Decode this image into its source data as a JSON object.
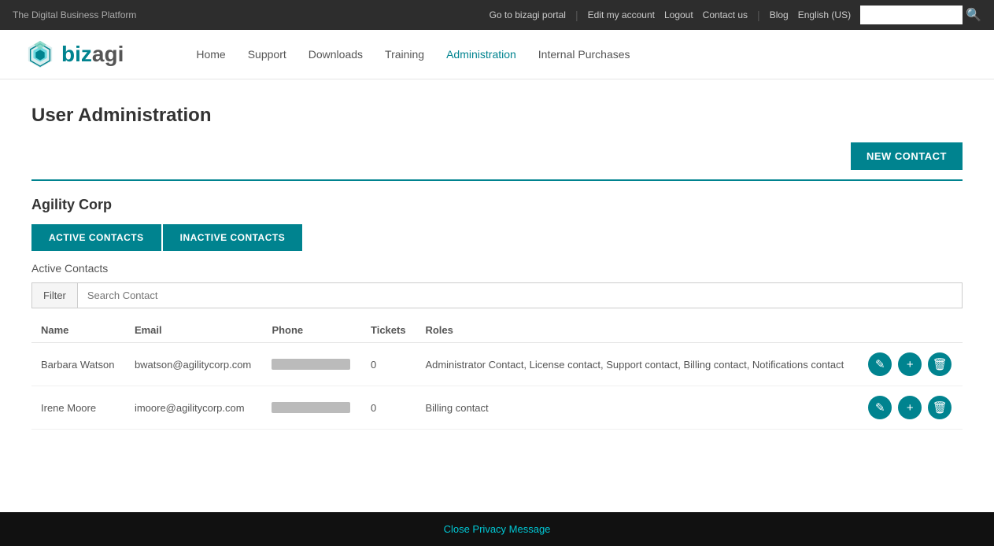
{
  "topbar": {
    "site_name": "The Digital Business Platform",
    "links": [
      {
        "label": "Go to bizagi portal",
        "id": "bizagi-portal"
      },
      {
        "label": "Edit my account",
        "id": "edit-account"
      },
      {
        "label": "Logout",
        "id": "logout"
      },
      {
        "label": "Contact us",
        "id": "contact-us"
      },
      {
        "label": "Blog",
        "id": "blog"
      }
    ],
    "language": "English (US)",
    "search_placeholder": ""
  },
  "navbar": {
    "logo_text_prefix": "bizagi",
    "links": [
      {
        "label": "Home",
        "id": "home",
        "active": false
      },
      {
        "label": "Support",
        "id": "support",
        "active": false
      },
      {
        "label": "Downloads",
        "id": "downloads",
        "active": false
      },
      {
        "label": "Training",
        "id": "training",
        "active": false
      },
      {
        "label": "Administration",
        "id": "administration",
        "active": true
      },
      {
        "label": "Internal Purchases",
        "id": "internal-purchases",
        "active": false
      }
    ]
  },
  "main": {
    "page_title": "User Administration",
    "new_contact_label": "NEW CONTACT",
    "company_name": "Agility Corp",
    "tabs": [
      {
        "label": "ACTIVE CONTACTS",
        "id": "active",
        "active": true
      },
      {
        "label": "INACTIVE CONTACTS",
        "id": "inactive",
        "active": false
      }
    ],
    "section_label": "Active Contacts",
    "filter_label": "Filter",
    "search_placeholder": "Search Contact",
    "table": {
      "headers": [
        "Name",
        "Email",
        "Phone",
        "Tickets",
        "Roles"
      ],
      "rows": [
        {
          "name": "Barbara Watson",
          "email": "bwatson@agilitycorp.com",
          "phone_hidden": true,
          "tickets": "0",
          "roles": "Administrator Contact, License contact, Support contact, Billing contact, Notifications contact"
        },
        {
          "name": "Irene Moore",
          "email": "imoore@agilitycorp.com",
          "phone_hidden": true,
          "tickets": "0",
          "roles": "Billing contact"
        }
      ]
    }
  },
  "privacy": {
    "link_label": "Close Privacy Message"
  },
  "icons": {
    "edit": "✎",
    "add": "+",
    "delete": "🗑"
  }
}
